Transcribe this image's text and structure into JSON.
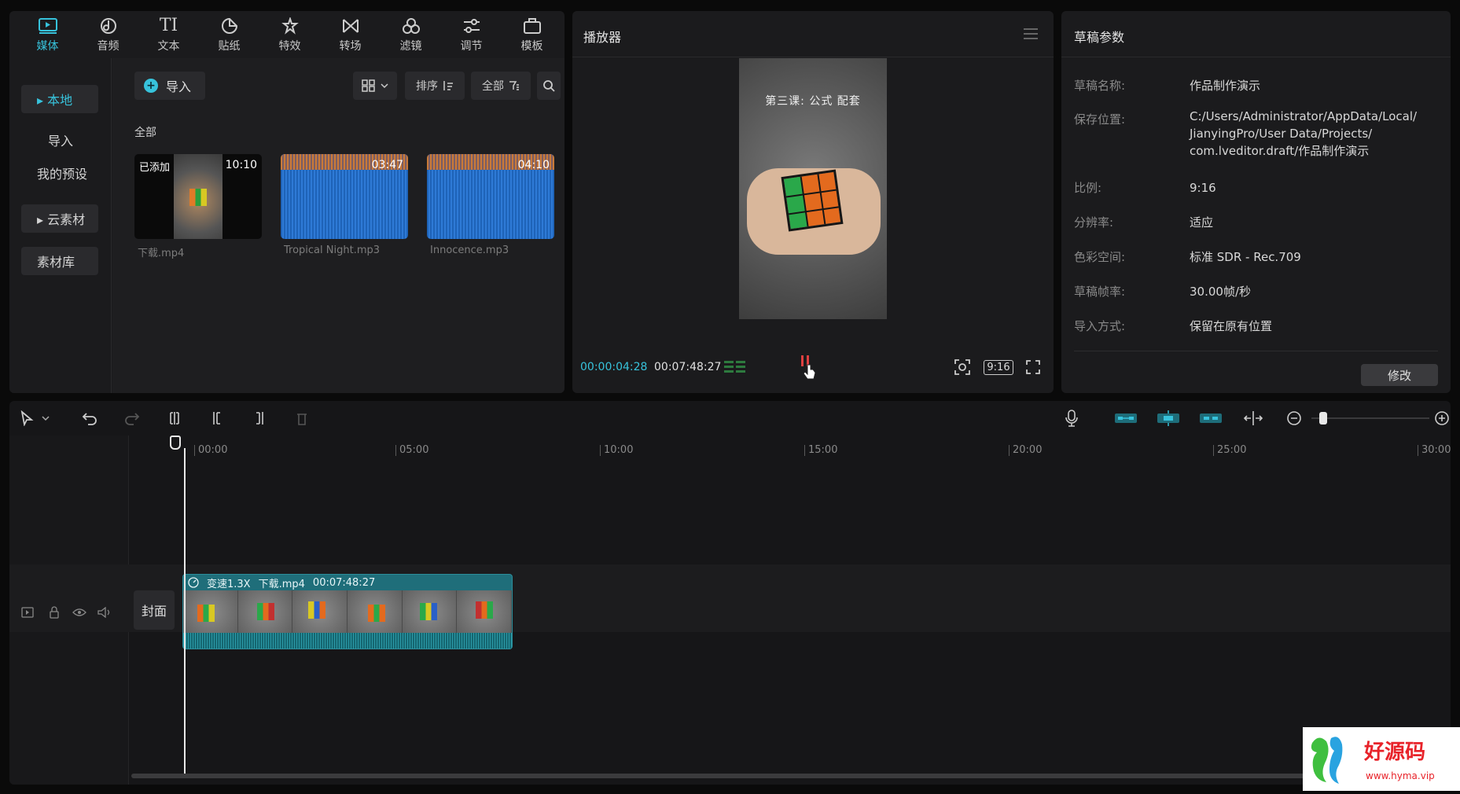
{
  "media": {
    "tabs": [
      {
        "label": "媒体",
        "icon": "media-icon"
      },
      {
        "label": "音频",
        "icon": "audio-icon"
      },
      {
        "label": "文本",
        "icon": "text-icon"
      },
      {
        "label": "贴纸",
        "icon": "sticker-icon"
      },
      {
        "label": "特效",
        "icon": "effects-icon"
      },
      {
        "label": "转场",
        "icon": "transition-icon"
      },
      {
        "label": "滤镜",
        "icon": "filter-icon"
      },
      {
        "label": "调节",
        "icon": "adjust-icon"
      },
      {
        "label": "模板",
        "icon": "template-icon"
      }
    ],
    "active_tab": "媒体",
    "sidebar": [
      "▸ 本地",
      "导入",
      "我的预设",
      "▸ 云素材",
      "素材库"
    ],
    "import_label": "导入",
    "sort_label": "排序",
    "filter_label": "全部",
    "section_label": "全部",
    "items": [
      {
        "name": "下载.mp4",
        "duration": "10:10",
        "badge": "已添加",
        "kind": "video"
      },
      {
        "name": "Tropical Night.mp3",
        "duration": "03:47",
        "kind": "audio"
      },
      {
        "name": "Innocence.mp3",
        "duration": "04:10",
        "kind": "audio"
      }
    ]
  },
  "player": {
    "title": "播放器",
    "video_caption": "第三课: 公式 配套",
    "current_time": "00:00:04:28",
    "total_time": "00:07:48:27",
    "ratio_label": "9:16"
  },
  "params": {
    "title": "草稿参数",
    "rows": [
      {
        "key": "草稿名称:",
        "value": "作品制作演示"
      },
      {
        "key": "保存位置:",
        "value": "C:/Users/Administrator/AppData/Local/ JianyingPro/User Data/Projects/ com.lveditor.draft/作品制作演示"
      },
      {
        "key": "比例:",
        "value": "9:16"
      },
      {
        "key": "分辨率:",
        "value": "适应"
      },
      {
        "key": "色彩空间:",
        "value": "标准 SDR - Rec.709"
      },
      {
        "key": "草稿帧率:",
        "value": "30.00帧/秒"
      },
      {
        "key": "导入方式:",
        "value": "保留在原有位置"
      }
    ],
    "modify_label": "修改"
  },
  "timeline": {
    "ruler_labels": [
      "00:00",
      "05:00",
      "10:00",
      "15:00",
      "20:00",
      "25:00",
      "30:00"
    ],
    "cover_label": "封面",
    "clip": {
      "speed": "变速1.3X",
      "name": "下载.mp4",
      "duration": "00:07:48:27"
    }
  },
  "colors": {
    "accent": "#37c3dc",
    "clip": "#1f6e7a",
    "audio": "#1e63b8"
  }
}
